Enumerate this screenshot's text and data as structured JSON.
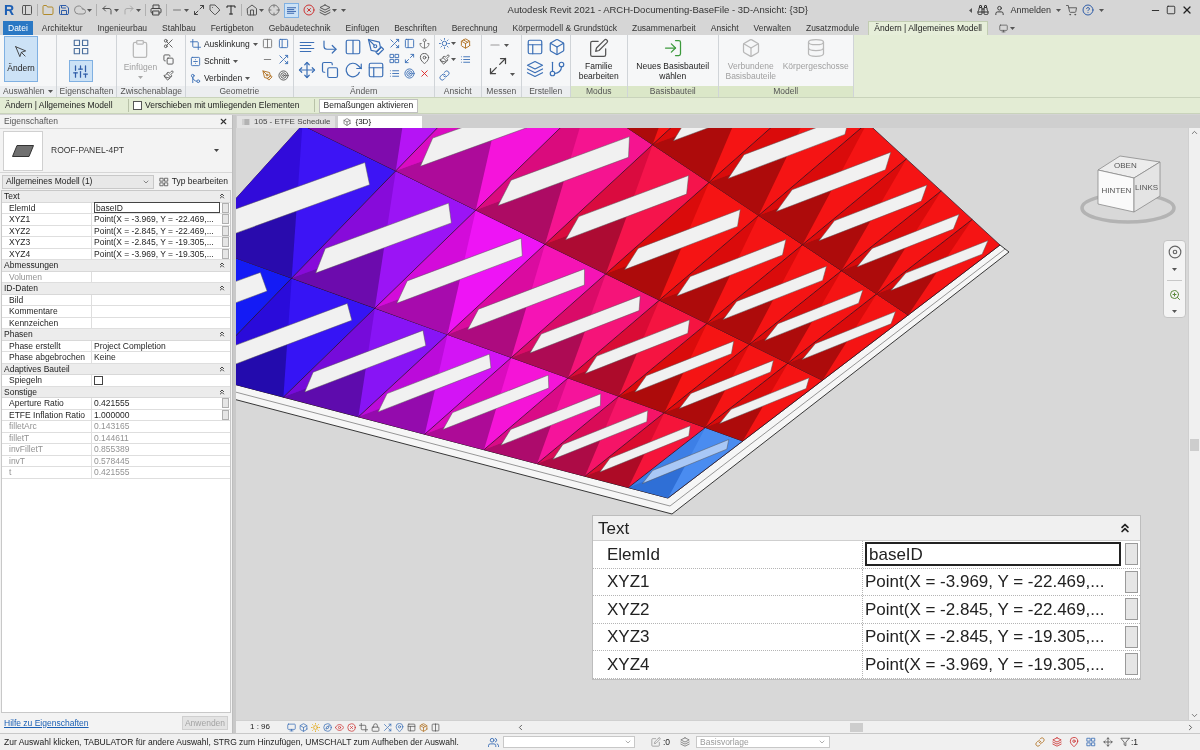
{
  "window": {
    "logo": "R",
    "title": "Autodesk Revit 2021 - ARCH-Documenting-BaseFile - 3D-Ansicht: {3D}",
    "sign_in": "Anmelden"
  },
  "quick_access_toolbar": {
    "thin_lines_on": true
  },
  "ribbon": {
    "tabs": [
      {
        "label": "Datei",
        "kind": "file",
        "selected": false
      },
      {
        "label": "Architektur",
        "kind": "tab",
        "selected": false
      },
      {
        "label": "Ingenieurbau",
        "kind": "tab",
        "selected": false
      },
      {
        "label": "Stahlbau",
        "kind": "tab",
        "selected": false
      },
      {
        "label": "Fertigbeton",
        "kind": "tab",
        "selected": false
      },
      {
        "label": "Gebäudetechnik",
        "kind": "tab",
        "selected": false
      },
      {
        "label": "Einfügen",
        "kind": "tab",
        "selected": false
      },
      {
        "label": "Beschriften",
        "kind": "tab",
        "selected": false
      },
      {
        "label": "Berechnung",
        "kind": "tab",
        "selected": false
      },
      {
        "label": "Körpermodell & Grundstück",
        "kind": "tab",
        "selected": false
      },
      {
        "label": "Zusammenarbeit",
        "kind": "tab",
        "selected": false
      },
      {
        "label": "Ansicht",
        "kind": "tab",
        "selected": false
      },
      {
        "label": "Verwalten",
        "kind": "tab",
        "selected": false
      },
      {
        "label": "Zusatzmodule",
        "kind": "tab",
        "selected": false
      },
      {
        "label": "Ändern | Allgemeines Modell",
        "kind": "contextual",
        "selected": true
      }
    ],
    "panels": [
      {
        "title": "Auswählen",
        "kind": "select",
        "contextual": false,
        "buttons": [
          {
            "label": "Ändern",
            "selected": true
          }
        ]
      },
      {
        "title": "Eigenschaften",
        "kind": "properties",
        "contextual": false,
        "on": true
      },
      {
        "title": "Zwischenablage",
        "kind": "clipboard",
        "contextual": false,
        "buttons": [
          {
            "label": "Einfügen",
            "disabled": true
          }
        ]
      },
      {
        "title": "Geometrie",
        "kind": "geometry",
        "contextual": false,
        "buttons": [
          {
            "label": "Ausklinkung",
            "disabled": false
          },
          {
            "label": "Schnitt",
            "disabled": false
          },
          {
            "label": "Verbinden",
            "disabled": false
          }
        ]
      },
      {
        "title": "Ändern",
        "kind": "modify",
        "contextual": false
      },
      {
        "title": "Ansicht",
        "kind": "view",
        "contextual": false
      },
      {
        "title": "Messen",
        "kind": "measure",
        "contextual": false
      },
      {
        "title": "Erstellen",
        "kind": "create",
        "contextual": false
      },
      {
        "title": "Modus",
        "kind": "mode",
        "contextual": true,
        "buttons": [
          {
            "label": "Familie bearbeiten",
            "disabled": false
          }
        ]
      },
      {
        "title": "Basisbauteil",
        "kind": "host",
        "contextual": true,
        "buttons": [
          {
            "label": "Neues Basisbauteil wählen",
            "disabled": false
          }
        ]
      },
      {
        "title": "Modell",
        "kind": "model",
        "contextual": true,
        "buttons": [
          {
            "label": "Verbundene Basisbauteile",
            "disabled": true
          },
          {
            "label": "Körpergeschosse",
            "disabled": true
          }
        ]
      }
    ]
  },
  "options_bar": {
    "context": "Ändern | Allgemeines Modell",
    "checkbox": {
      "label": "Verschieben mit umliegenden Elementen",
      "checked": false
    },
    "button": "Bemaßungen aktivieren"
  },
  "properties": {
    "title": "Eigenschaften",
    "type_name": "ROOF-PANEL-4PT",
    "filter": "Allgemeines Modell (1)",
    "edit_type": "Typ bearbeiten",
    "groups": [
      {
        "name": "Text",
        "expanded": true,
        "rows": [
          {
            "label": "ElemId",
            "value": "baseID",
            "kind": "field",
            "disabled": false
          },
          {
            "label": "XYZ1",
            "value": "Point(X = -3.969, Y = -22.469,...",
            "kind": "button",
            "disabled": false
          },
          {
            "label": "XYZ2",
            "value": "Point(X = -2.845, Y = -22.469,...",
            "kind": "button",
            "disabled": false
          },
          {
            "label": "XYZ3",
            "value": "Point(X = -2.845, Y = -19.305,...",
            "kind": "button",
            "disabled": false
          },
          {
            "label": "XYZ4",
            "value": "Point(X = -3.969, Y = -19.305,...",
            "kind": "button",
            "disabled": false
          }
        ]
      },
      {
        "name": "Abmessungen",
        "expanded": true,
        "rows": [
          {
            "label": "Volumen",
            "kind": "text",
            "disabled": true
          }
        ]
      },
      {
        "name": "ID-Daten",
        "expanded": true,
        "rows": [
          {
            "label": "Bild",
            "kind": "text",
            "disabled": false
          },
          {
            "label": "Kommentare",
            "kind": "text",
            "disabled": false
          },
          {
            "label": "Kennzeichen",
            "kind": "text",
            "disabled": false
          }
        ]
      },
      {
        "name": "Phasen",
        "expanded": true,
        "rows": [
          {
            "label": "Phase erstellt",
            "value": "Project Completion",
            "kind": "text",
            "disabled": false
          },
          {
            "label": "Phase abgebrochen",
            "value": "Keine",
            "kind": "text",
            "disabled": false
          }
        ]
      },
      {
        "name": "Adaptives Bauteil",
        "expanded": true,
        "rows": [
          {
            "label": "Spiegeln",
            "kind": "checkbox",
            "checked": false,
            "disabled": false
          }
        ]
      },
      {
        "name": "Sonstige",
        "expanded": true,
        "rows": [
          {
            "label": "Aperture Ratio",
            "value": "0.421555",
            "kind": "button",
            "disabled": false
          },
          {
            "label": "ETFE Inflation Ratio",
            "value": "1.000000",
            "kind": "button",
            "disabled": false
          },
          {
            "label": "filletArc",
            "value": "0.143165",
            "kind": "text",
            "disabled": true
          },
          {
            "label": "filletT",
            "value": "0.144611",
            "kind": "text",
            "disabled": true
          },
          {
            "label": "invFilletT",
            "value": "0.855389",
            "kind": "text",
            "disabled": true
          },
          {
            "label": "invT",
            "value": "0.578445",
            "kind": "text",
            "disabled": true
          },
          {
            "label": "t",
            "value": "0.421555",
            "kind": "text",
            "disabled": true
          }
        ]
      }
    ],
    "help_link": "Hilfe zu Eigenschaften",
    "apply": {
      "label": "Anwenden",
      "disabled": true
    }
  },
  "view_tabs": [
    {
      "label": "105 - ETFE Schedule",
      "kind": "schedule",
      "selected": false
    },
    {
      "label": "{3D}",
      "kind": "model",
      "selected": true
    }
  ],
  "view": {
    "scale": "1 : 96",
    "viewcube": {
      "top": "OBEN",
      "front": "HINTEN",
      "side": "LINKS"
    },
    "inset": {
      "group": "Text",
      "expanded": true,
      "rows": [
        {
          "label": "ElemId",
          "value": "baseID",
          "kind": "field"
        },
        {
          "label": "XYZ1",
          "value": "Point(X = -3.969, Y = -22.469,...",
          "kind": "button"
        },
        {
          "label": "XYZ2",
          "value": "Point(X = -2.845, Y = -22.469,...",
          "kind": "button"
        },
        {
          "label": "XYZ3",
          "value": "Point(X = -2.845, Y = -19.305,...",
          "kind": "button"
        },
        {
          "label": "XYZ4",
          "value": "Point(X = -3.969, Y = -19.305,...",
          "kind": "button"
        }
      ]
    }
  },
  "status_bar": {
    "message": "Zur Auswahl klicken, TABULATOR für andere Auswahl, STRG zum Hinzufügen, UMSCHALT zum Aufheben der Auswahl.",
    "editable_count": ":0",
    "design_option": "Basisvorlage",
    "filter_count": ":1"
  }
}
